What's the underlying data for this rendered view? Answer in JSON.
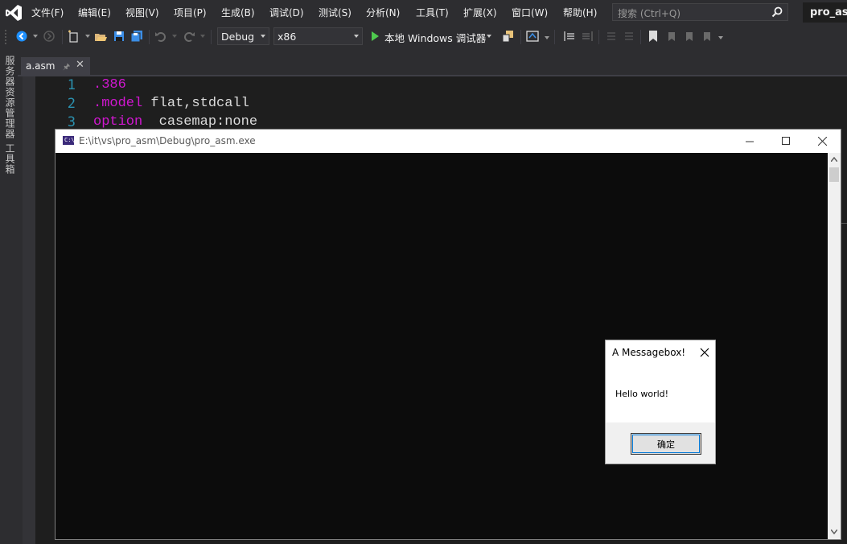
{
  "menubar": {
    "items": [
      "文件(F)",
      "编辑(E)",
      "视图(V)",
      "项目(P)",
      "生成(B)",
      "调试(D)",
      "测试(S)",
      "分析(N)",
      "工具(T)",
      "扩展(X)",
      "窗口(W)",
      "帮助(H)"
    ],
    "search_placeholder": "搜索 (Ctrl+Q)",
    "project_name": "pro_asm"
  },
  "toolbar": {
    "configuration": "Debug",
    "platform": "x86",
    "run_label": "本地 Windows 调试器",
    "run_color": "#4ec94e"
  },
  "side_strip": {
    "tabs": [
      "服务器资源管理器",
      "工具箱"
    ]
  },
  "document_tab": {
    "label": "a.asm"
  },
  "editor": {
    "lines": [
      {
        "num": "1",
        "keyword": ".386",
        "rest": ""
      },
      {
        "num": "2",
        "keyword": ".model",
        "rest": " flat,stdcall"
      },
      {
        "num": "3",
        "keyword": "option",
        "rest": "  casemap:none"
      }
    ],
    "keyword_color": "#d017d0",
    "line_number_color": "#2b91af"
  },
  "console": {
    "title": "E:\\it\\vs\\pro_asm\\Debug\\pro_asm.exe",
    "app_icon_text": "C:\\"
  },
  "messagebox": {
    "title": "A Messagebox!",
    "text": "Hello world!",
    "ok_label": "确定"
  }
}
